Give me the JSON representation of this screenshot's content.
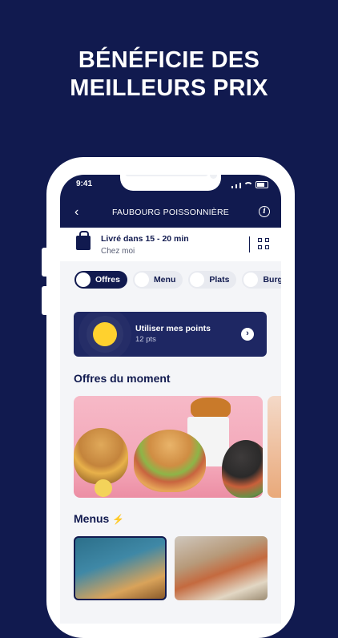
{
  "headline": {
    "line1": "BÉNÉFICIE DES",
    "line2": "MEILLEURS PRIX"
  },
  "status_bar": {
    "time": "9:41"
  },
  "nav": {
    "title": "FAUBOURG POISSONNIÈRE",
    "back_icon": "chevron-left-icon",
    "info_icon": "info-icon"
  },
  "delivery": {
    "line1": "Livré dans 15 - 20 min",
    "line2": "Chez moi"
  },
  "tabs": [
    {
      "label": "Offres",
      "active": true
    },
    {
      "label": "Menu",
      "active": false
    },
    {
      "label": "Plats",
      "active": false
    },
    {
      "label": "Burg",
      "active": false
    }
  ],
  "points": {
    "title": "Utiliser mes points",
    "value": "12 pts"
  },
  "sections": {
    "offers": "Offres du moment",
    "menus": "Menus",
    "menus_icon": "⚡"
  },
  "colors": {
    "brand": "#111a4f",
    "accent": "#ffd12e",
    "offer_bg": "#f3a6b8"
  }
}
